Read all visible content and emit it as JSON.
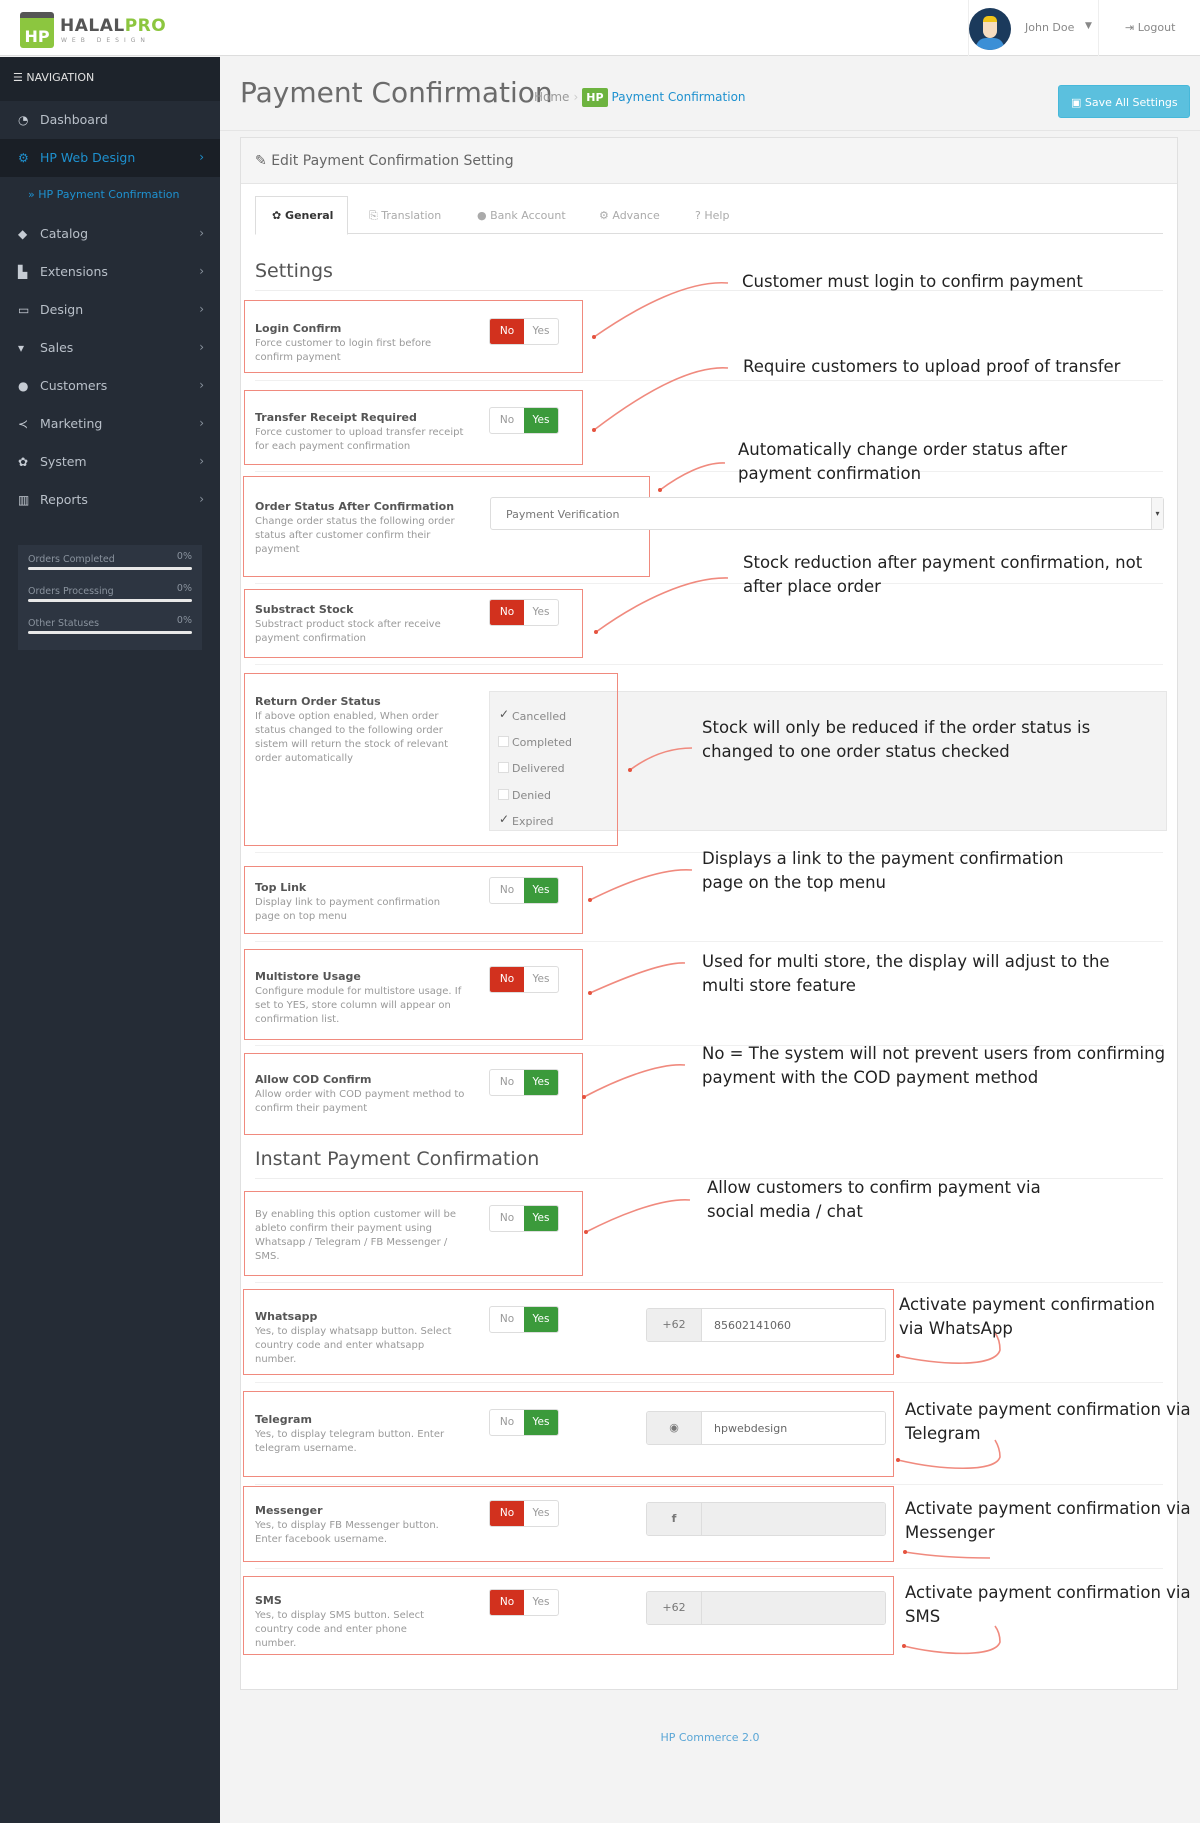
{
  "header": {
    "logo_mark": "HP",
    "logo_name_a": "HALAL",
    "logo_name_b": "PRO",
    "logo_sub": "WEB DESIGN",
    "user_name": "John Doe",
    "logout_label": "Logout"
  },
  "sidebar": {
    "nav_title": "NAVIGATION",
    "items": [
      {
        "label": "Dashboard",
        "icon": "dashboard-icon",
        "chevron": false
      },
      {
        "label": "HP Web Design",
        "icon": "cogs-icon",
        "chevron": true,
        "active": true
      },
      {
        "label": "Catalog",
        "icon": "tags-icon",
        "chevron": true
      },
      {
        "label": "Extensions",
        "icon": "puzzle-icon",
        "chevron": true
      },
      {
        "label": "Design",
        "icon": "monitor-icon",
        "chevron": true
      },
      {
        "label": "Sales",
        "icon": "cart-icon",
        "chevron": true
      },
      {
        "label": "Customers",
        "icon": "user-icon",
        "chevron": true
      },
      {
        "label": "Marketing",
        "icon": "share-icon",
        "chevron": true
      },
      {
        "label": "System",
        "icon": "gear-icon",
        "chevron": true
      },
      {
        "label": "Reports",
        "icon": "bar-chart-icon",
        "chevron": true
      }
    ],
    "sub_item": "HP Payment Confirmation",
    "stats": [
      {
        "label": "Orders Completed",
        "value": "0%",
        "fraction": 0
      },
      {
        "label": "Orders Processing",
        "value": "0%",
        "fraction": 0
      },
      {
        "label": "Other Statuses",
        "value": "0%",
        "fraction": 0
      }
    ]
  },
  "page": {
    "title": "Payment Confirmation",
    "breadcrumb": {
      "home": "Home",
      "badge": "HP",
      "current": "Payment Confirmation"
    },
    "save_label": "Save All Settings"
  },
  "panel": {
    "title": "Edit Payment Confirmation Setting",
    "tabs": [
      {
        "label": "General",
        "active": true
      },
      {
        "label": "Translation"
      },
      {
        "label": "Bank Account"
      },
      {
        "label": "Advance"
      },
      {
        "label": "Help"
      }
    ],
    "section_settings": "Settings",
    "section_instant": "Instant Payment Confirmation",
    "toggle_no": "No",
    "toggle_yes": "Yes",
    "settings": {
      "login_confirm": {
        "title": "Login Confirm",
        "help": "Force customer to login first before confirm payment",
        "value": "No"
      },
      "transfer_receipt": {
        "title": "Transfer Receipt Required",
        "help": "Force customer to upload transfer receipt for each payment confirmation",
        "value": "Yes"
      },
      "order_status": {
        "title": "Order Status After Confirmation",
        "help": "Change order status the following order status after customer confirm their payment",
        "selected": "Payment Verification"
      },
      "substract_stock": {
        "title": "Substract Stock",
        "help": "Substract product stock after receive payment confirmation",
        "value": "No"
      },
      "return_order": {
        "title": "Return Order Status",
        "help": "If above option enabled, When order status changed to the following order sistem will return the stock of relevant order automatically",
        "options": [
          {
            "label": "Cancelled",
            "checked": true
          },
          {
            "label": "Completed",
            "checked": false
          },
          {
            "label": "Delivered",
            "checked": false
          },
          {
            "label": "Denied",
            "checked": false
          },
          {
            "label": "Expired",
            "checked": true
          }
        ]
      },
      "top_link": {
        "title": "Top Link",
        "help": "Display link to payment confirmation page on top menu",
        "value": "Yes"
      },
      "multistore": {
        "title": "Multistore Usage",
        "help": "Configure module for multistore usage. If set to YES, store column will appear on confirmation list.",
        "value": "No"
      },
      "cod_confirm": {
        "title": "Allow COD Confirm",
        "help": "Allow order with COD payment method to confirm their payment",
        "value": "Yes"
      }
    },
    "instant": {
      "enable": {
        "help": "By enabling this option customer will be ableto confirm their payment using Whatsapp / Telegram / FB Messenger / SMS.",
        "value": "Yes"
      },
      "whatsapp": {
        "title": "Whatsapp",
        "help": "Yes, to display whatsapp button. Select country code and enter whatsapp number.",
        "value": "Yes",
        "addon": "+62",
        "input": "85602141060"
      },
      "telegram": {
        "title": "Telegram",
        "help": "Yes, to display telegram button. Enter telegram username.",
        "value": "Yes",
        "addon_icon": "telegram-icon",
        "input": "hpwebdesign"
      },
      "messenger": {
        "title": "Messenger",
        "help": "Yes, to display FB Messenger button. Enter facebook username.",
        "value": "No",
        "addon": "f",
        "input": ""
      },
      "sms": {
        "title": "SMS",
        "help": "Yes, to display SMS button. Select country code and enter phone number.",
        "value": "No",
        "addon": "+62",
        "input": ""
      }
    }
  },
  "annotations": [
    "Customer must login to confirm payment",
    "Require customers to upload proof of transfer",
    "Automatically change order status after payment confirmation",
    "Stock reduction after payment confirmation, not after place order",
    "Stock will only be reduced if the order status is changed to one order status checked",
    "Displays a link to the payment confirmation page on the top menu",
    "Used for multi store, the display will adjust to the multi store feature",
    "No = The system will not prevent users from confirming payment with the COD payment method",
    "Allow customers to confirm payment via social media / chat",
    "Activate payment confirmation via WhatsApp",
    "Activate payment confirmation via Telegram",
    "Activate payment confirmation via Messenger",
    "Activate payment confirmation via SMS"
  ],
  "footer": "HP Commerce 2.0"
}
